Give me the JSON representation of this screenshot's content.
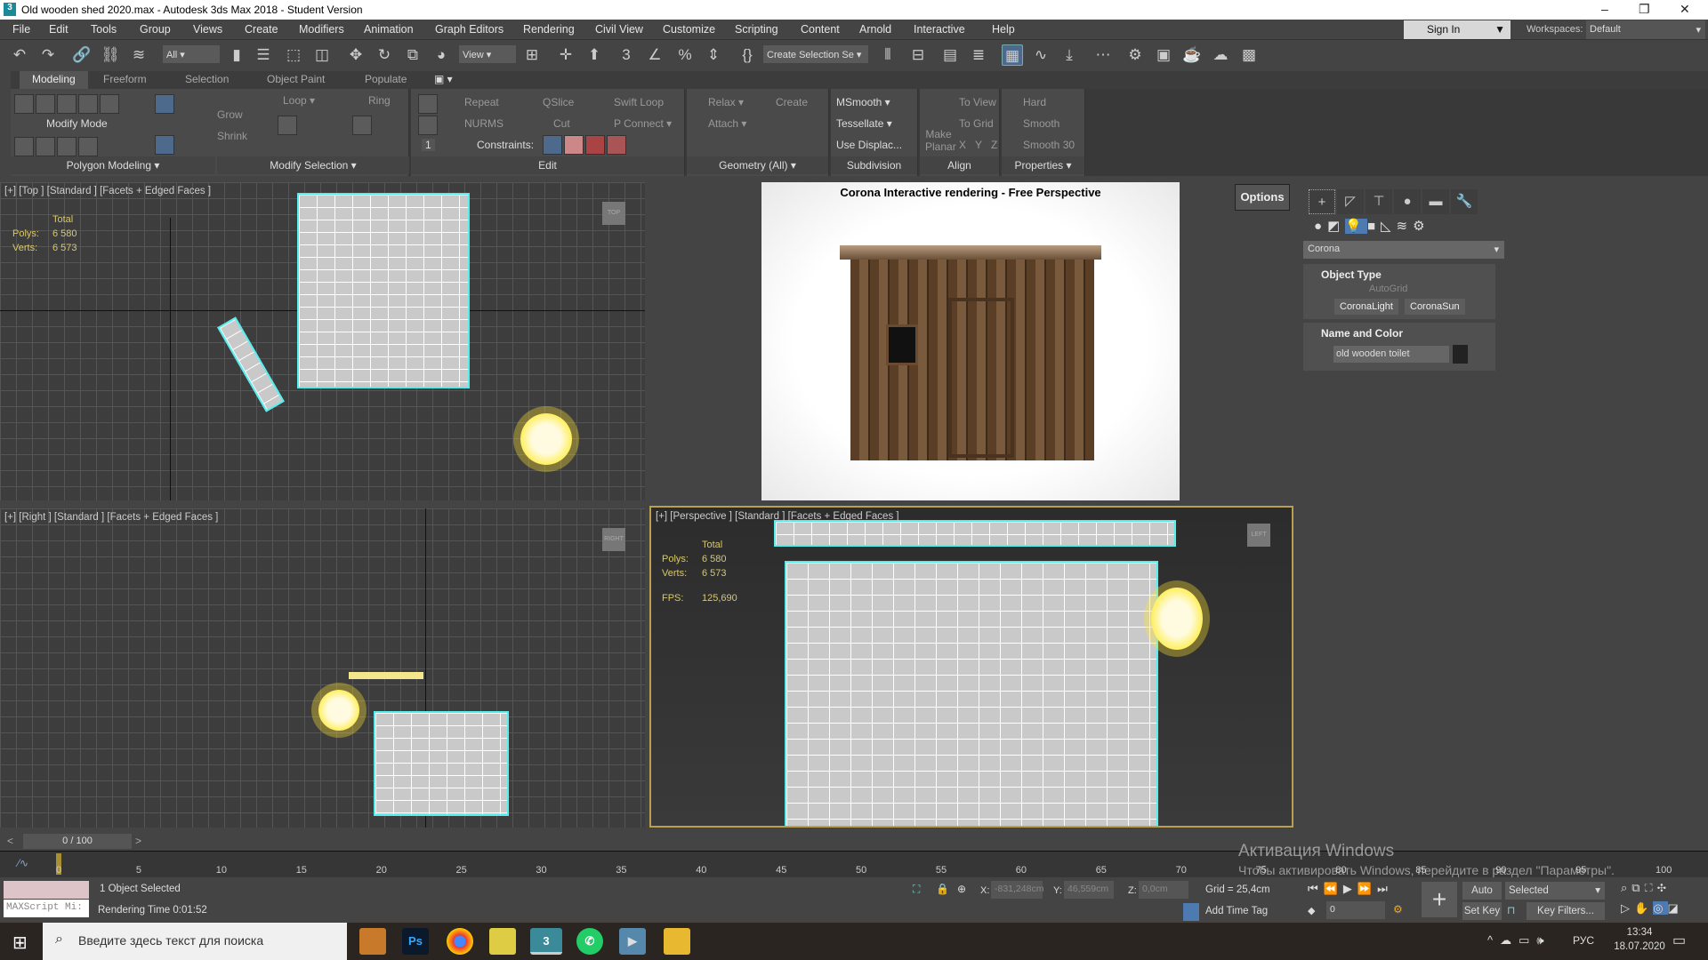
{
  "window": {
    "title": "Old wooden shed 2020.max - Autodesk 3ds Max 2018 - Student Version",
    "app_icon": "3",
    "minimize": "–",
    "restore": "❐",
    "close": "✕"
  },
  "menu": [
    "File",
    "Edit",
    "Tools",
    "Group",
    "Views",
    "Create",
    "Modifiers",
    "Animation",
    "Graph Editors",
    "Rendering",
    "Civil View",
    "Customize",
    "Scripting",
    "Content",
    "Arnold",
    "Interactive",
    "Help"
  ],
  "account": {
    "sign_in": "Sign In",
    "workspaces_label": "Workspaces:",
    "workspace": "Default"
  },
  "toolbar": {
    "filter": "All",
    "ref_coord": "View",
    "selection_set": "Create Selection Se"
  },
  "ribbon_tabs": [
    "Modeling",
    "Freeform",
    "Selection",
    "Object Paint",
    "Populate"
  ],
  "ribbon": {
    "polygon_modeling": {
      "label": "Polygon Modeling ▾",
      "modify_mode": "Modify Mode"
    },
    "modify_selection": {
      "label": "Modify Selection ▾",
      "grow": "Grow",
      "shrink": "Shrink",
      "loop": "Loop ▾",
      "ring": "Ring"
    },
    "edit": {
      "label": "Edit",
      "repeat": "Repeat",
      "qslice": "QSlice",
      "swift_loop": "Swift Loop",
      "nurms": "NURMS",
      "cut": "Cut",
      "p_connect": "P Connect ▾",
      "constraints": "Constraints:",
      "spinner": "1"
    },
    "geometry": {
      "label": "Geometry (All) ▾",
      "relax": "Relax ▾",
      "create": "Create",
      "attach": "Attach ▾"
    },
    "subdivision": {
      "label": "Subdivision",
      "msmooth": "MSmooth ▾",
      "tessellate": "Tessellate ▾",
      "use_displace": "Use Displac..."
    },
    "align": {
      "label": "Align",
      "make_planar": "Make Planar",
      "to_view": "To View",
      "to_grid": "To Grid",
      "x": "X",
      "y": "Y",
      "z": "Z"
    },
    "properties": {
      "label": "Properties ▾",
      "hard": "Hard",
      "smooth": "Smooth",
      "smooth30": "Smooth 30"
    }
  },
  "viewports": {
    "top": {
      "label": "[+] [Top ] [Standard ] [Facets + Edged Faces ]",
      "cube": "TOP"
    },
    "right": {
      "label": "[+] [Right ] [Standard ] [Facets + Edged Faces ]",
      "cube": "RIGHT"
    },
    "perspective": {
      "label": "[+] [Perspective ] [Standard ] [Facets + Edged Faces ]",
      "cube": "LEFT",
      "fps_label": "FPS:",
      "fps": "125,690"
    },
    "stats": {
      "total": "Total",
      "polys_label": "Polys:",
      "polys": "6 580",
      "verts_label": "Verts:",
      "verts": "6 573"
    },
    "render": {
      "title": "Corona Interactive rendering - Free Perspective",
      "options": "Options"
    }
  },
  "command_panel": {
    "category": "Corona",
    "object_type": "Object Type",
    "autogrid": "AutoGrid",
    "btn1": "CoronaLight",
    "btn2": "CoronaSun",
    "name_color": "Name and Color",
    "object_name": "old wooden toilet",
    "object_color": "#222222"
  },
  "timeline": {
    "frame": "0 / 100",
    "ticks": [
      "0",
      "5",
      "10",
      "15",
      "20",
      "25",
      "30",
      "35",
      "40",
      "45",
      "50",
      "55",
      "60",
      "65",
      "70",
      "75",
      "80",
      "85",
      "90",
      "95",
      "100"
    ]
  },
  "status": {
    "maxscript": "MAXScript Mi:",
    "selected": "1 Object Selected",
    "render_time": "Rendering Time  0:01:52",
    "x_label": "X:",
    "x": "-831,248cm",
    "y_label": "Y:",
    "y": "46,559cm",
    "z_label": "Z:",
    "z": "0,0cm",
    "grid": "Grid = 25,4cm",
    "add_time_tag": "Add Time Tag",
    "auto_key": "Auto Key",
    "set_key": "Set Key",
    "key_mode": "Selected",
    "key_filters": "Key Filters...",
    "frame_field": "0"
  },
  "watermark": {
    "line1": "Активация Windows",
    "line2": "Чтобы активировать Windows, перейдите в раздел \"Параметры\"."
  },
  "taskbar": {
    "search_placeholder": "Введите здесь текст для поиска",
    "lang": "РУС",
    "time": "13:34",
    "date": "18.07.2020"
  }
}
